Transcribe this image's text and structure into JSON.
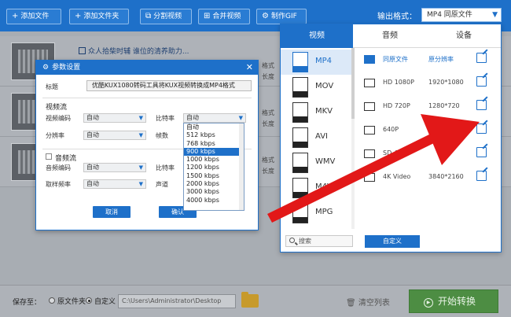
{
  "toolbar": {
    "add_file": "添加文件",
    "add_folder": "添加文件夹",
    "split_video": "分割视频",
    "merge_video": "合并视频",
    "make_gif": "制作GIF",
    "output_format_label": "输出格式：",
    "output_format_value": "MP4  同原文件"
  },
  "file_list": {
    "rows": [
      {
        "title": "众人拾柴时辅 谁位的清养助力..."
      },
      {
        "title": ""
      },
      {
        "title": ""
      }
    ],
    "side_labels": [
      "格式",
      "长度",
      "格式",
      "长度",
      "格式",
      "长度"
    ]
  },
  "bottom": {
    "save_to": "保存至：",
    "option_original": "原文件夹",
    "option_custom": "自定义",
    "path": "C:\\Users\\Administrator\\Desktop",
    "clear_list": "清空列表",
    "start": "开始转换"
  },
  "param_dialog": {
    "title": "参数设置",
    "filename_label": "标题",
    "filename_value": "优酷KUX1080转码工具将KUX视频转换成MP4格式",
    "video_section": "视频流",
    "audio_section": "音频流",
    "labels": {
      "video_codec": "视频编码",
      "resolution": "分辨率",
      "bitrate": "比特率",
      "framerate": "帧数",
      "audio_codec": "音频编码",
      "audio_bitrate": "比特率",
      "sample_rate": "取样频率",
      "channel": "声道"
    },
    "values": {
      "video_codec": "自动",
      "resolution": "自动",
      "bitrate": "自动",
      "audio_codec": "自动",
      "sample_rate": "自动"
    },
    "cancel": "取消",
    "confirm": "确认"
  },
  "bitrate_dropdown": {
    "options": [
      "自动",
      "512 kbps",
      "768 kbps",
      "900 kbps",
      "1000 kbps",
      "1200 kbps",
      "1500 kbps",
      "2000 kbps",
      "3000 kbps",
      "4000 kbps"
    ],
    "selected_index": 3
  },
  "format_panel": {
    "tabs": [
      "视频",
      "音频",
      "设备"
    ],
    "active_tab": 0,
    "formats": [
      "MP4",
      "MOV",
      "MKV",
      "AVI",
      "WMV",
      "M4V",
      "MPG"
    ],
    "active_format": 0,
    "presets": [
      {
        "name": "同原文件",
        "res": "原分辨率"
      },
      {
        "name": "HD 1080P",
        "res": "1920*1080"
      },
      {
        "name": "HD 720P",
        "res": "1280*720"
      },
      {
        "name": "640P",
        "res": "960*640"
      },
      {
        "name": "SD 480P",
        "res": ""
      },
      {
        "name": "4K Video",
        "res": "3840*2160"
      }
    ],
    "search_placeholder": "搜索",
    "custom_button": "自定义"
  },
  "colors": {
    "brand_blue": "#1e70c9",
    "start_green": "#4d8d43",
    "arrow_red": "#e21818"
  }
}
